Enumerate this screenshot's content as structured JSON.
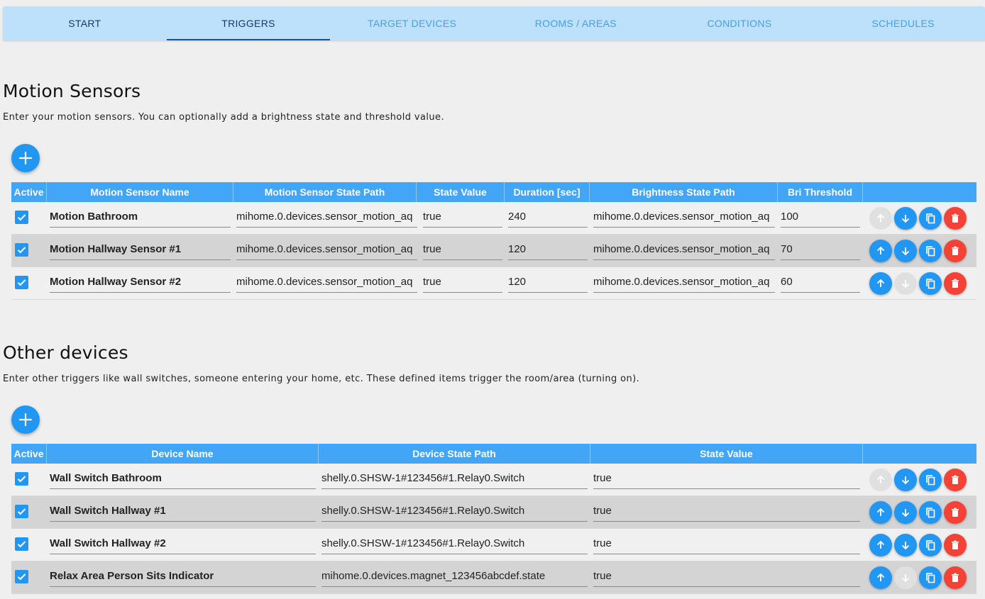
{
  "tabs": [
    {
      "label": "START",
      "state": "done"
    },
    {
      "label": "TRIGGERS",
      "state": "active"
    },
    {
      "label": "TARGET DEVICES",
      "state": ""
    },
    {
      "label": "ROOMS / AREAS",
      "state": ""
    },
    {
      "label": "CONDITIONS",
      "state": ""
    },
    {
      "label": "SCHEDULES",
      "state": ""
    }
  ],
  "motion": {
    "title": "Motion Sensors",
    "description": "Enter your motion sensors. You can optionally add a brightness state and threshold value.",
    "add_icon": "plus-icon",
    "headers": [
      "Active",
      "Motion Sensor Name",
      "Motion Sensor State Path",
      "State Value",
      "Duration [sec]",
      "Brightness State Path",
      "Bri Threshold",
      ""
    ],
    "rows": [
      {
        "active": true,
        "name": "Motion Bathroom",
        "state_path": "mihome.0.devices.sensor_motion_aq",
        "state_value": "true",
        "duration": "240",
        "bri_path": "mihome.0.devices.sensor_motion_aq",
        "bri_threshold": "100"
      },
      {
        "active": true,
        "name": "Motion Hallway Sensor #1",
        "state_path": "mihome.0.devices.sensor_motion_aq",
        "state_value": "true",
        "duration": "120",
        "bri_path": "mihome.0.devices.sensor_motion_aq",
        "bri_threshold": "70"
      },
      {
        "active": true,
        "name": "Motion Hallway Sensor #2",
        "state_path": "mihome.0.devices.sensor_motion_aq",
        "state_value": "true",
        "duration": "120",
        "bri_path": "mihome.0.devices.sensor_motion_aq",
        "bri_threshold": "60"
      }
    ]
  },
  "other": {
    "title": "Other devices",
    "description": "Enter other triggers like wall switches, someone entering your home, etc. These defined items trigger the room/area (turning on).",
    "add_icon": "plus-icon",
    "headers": [
      "Active",
      "Device Name",
      "Device State Path",
      "State Value",
      ""
    ],
    "rows": [
      {
        "active": true,
        "name": "Wall Switch Bathroom",
        "state_path": "shelly.0.SHSW-1#123456#1.Relay0.Switch",
        "state_value": "true"
      },
      {
        "active": true,
        "name": "Wall Switch Hallway #1",
        "state_path": "shelly.0.SHSW-1#123456#1.Relay0.Switch",
        "state_value": "true"
      },
      {
        "active": true,
        "name": "Wall Switch Hallway #2",
        "state_path": "shelly.0.SHSW-1#123456#1.Relay0.Switch",
        "state_value": "true"
      },
      {
        "active": true,
        "name": "Relax Area Person Sits Indicator",
        "state_path": "mihome.0.devices.magnet_123456abcdef.state",
        "state_value": "true"
      }
    ]
  },
  "row_actions": [
    "arrow-up-icon",
    "arrow-down-icon",
    "copy-icon",
    "delete-icon"
  ],
  "colors": {
    "accent": "#2196f3",
    "header": "#42a5f5",
    "delete": "#f44336",
    "tab_bar": "#bde0fb",
    "disabled": "#e0e0e0"
  }
}
